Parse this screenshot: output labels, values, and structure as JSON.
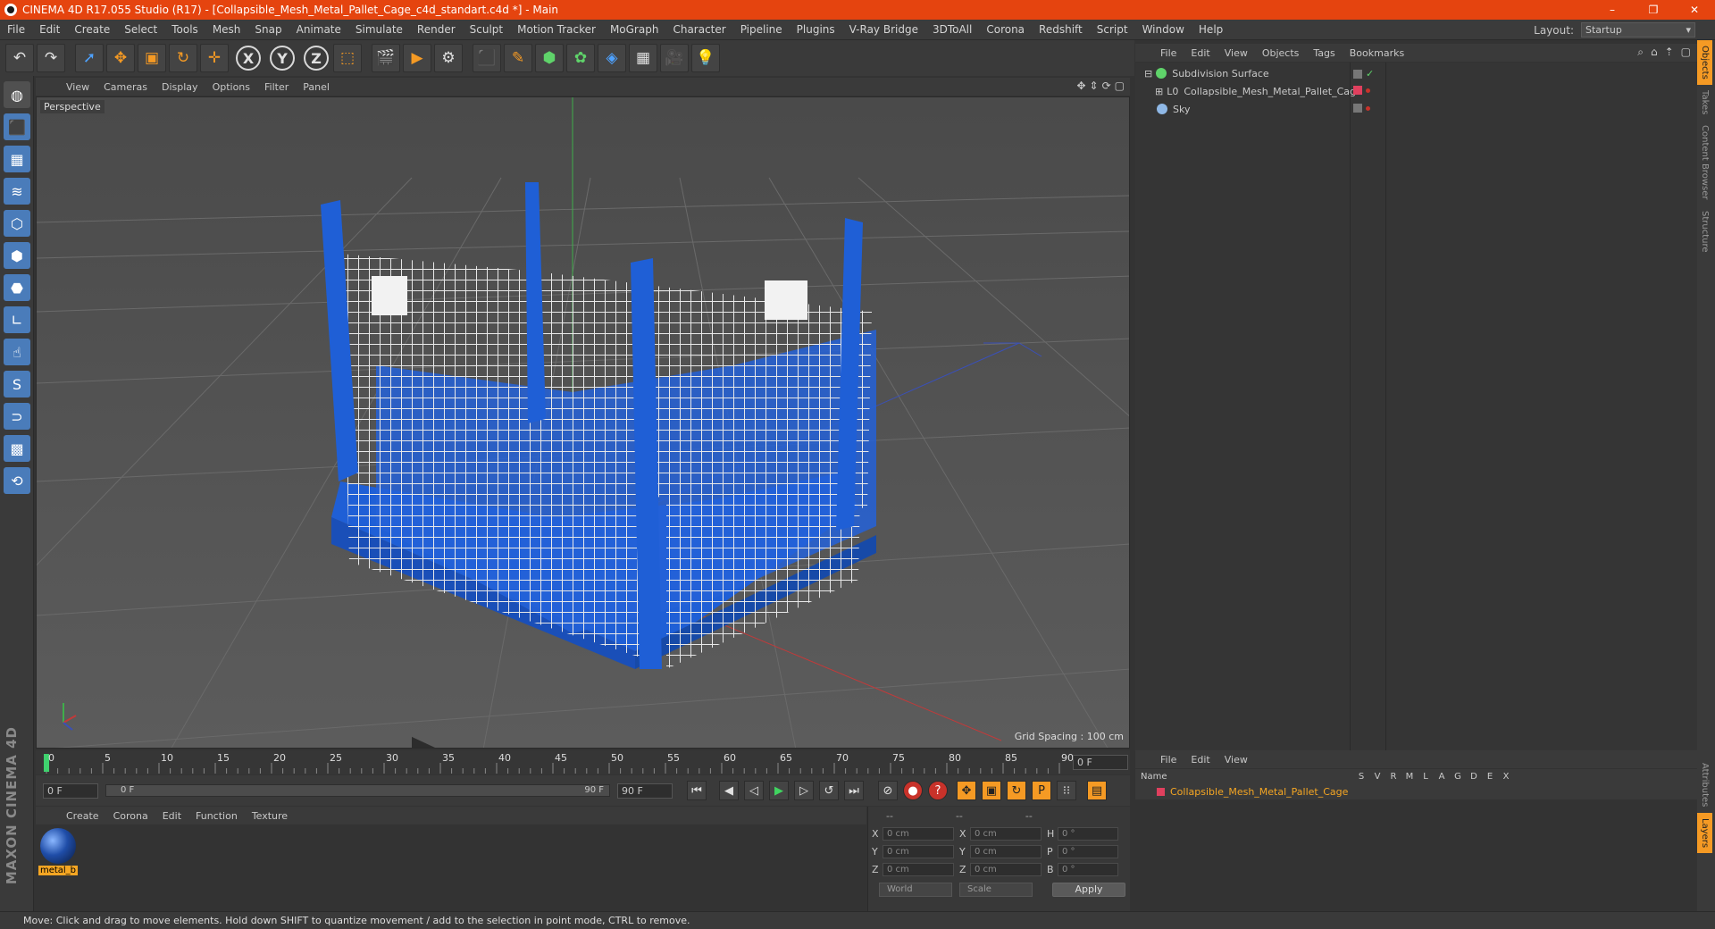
{
  "window": {
    "title": "CINEMA 4D R17.055 Studio (R17) - [Collapsible_Mesh_Metal_Pallet_Cage_c4d_standart.c4d *] - Main",
    "controls": [
      "–",
      "❐",
      "✕"
    ]
  },
  "menubar": {
    "items": [
      "File",
      "Edit",
      "Create",
      "Select",
      "Tools",
      "Mesh",
      "Snap",
      "Animate",
      "Simulate",
      "Render",
      "Sculpt",
      "Motion Tracker",
      "MoGraph",
      "Character",
      "Pipeline",
      "Plugins",
      "V-Ray Bridge",
      "3DToAll",
      "Corona",
      "Redshift",
      "Script",
      "Window",
      "Help"
    ],
    "layout_label": "Layout:",
    "layout_value": "Startup"
  },
  "toolbar": {
    "undo_icon": "↶",
    "redo_icon": "↷",
    "select_icon": "➚",
    "move_icon": "✥",
    "scale_icon": "▣",
    "rotate_icon": "↻",
    "transform_icon": "✛",
    "axis_x": "X",
    "axis_y": "Y",
    "axis_z": "Z",
    "coord_icon": "⬚",
    "render_view_icon": "🎬",
    "render_icon": "▶",
    "render_settings_icon": "⚙",
    "cube_icon": "⬛",
    "pen_icon": "✎",
    "subdiv_icon": "⬢",
    "cloner_icon": "✿",
    "deformer_icon": "◈",
    "scene_icon": "▦",
    "camera_icon": "🎥",
    "light_icon": "💡"
  },
  "left_tools": {
    "icons": [
      "◍",
      "⬛",
      "▦",
      "≋",
      "⬡",
      "⬢",
      "⬣",
      "∟",
      "☝",
      "S",
      "⊃",
      "▩",
      "⟲"
    ],
    "brand": "MAXON CINEMA 4D"
  },
  "viewport": {
    "menu": [
      "View",
      "Cameras",
      "Display",
      "Options",
      "Filter",
      "Panel"
    ],
    "nav_icons": [
      "✥",
      "⇕",
      "⟳",
      "▢"
    ],
    "camera_label": "Perspective",
    "grid_spacing": "Grid Spacing : 100 cm"
  },
  "timeline": {
    "ticks": [
      "0",
      "5",
      "10",
      "15",
      "20",
      "25",
      "30",
      "35",
      "40",
      "45",
      "50",
      "55",
      "60",
      "65",
      "70",
      "75",
      "80",
      "85",
      "90"
    ],
    "current_frame": "0 F"
  },
  "transport": {
    "start_field": "0 F",
    "slider_start": "0 F",
    "slider_end": "90 F",
    "end_field": "90 F",
    "buttons": [
      "⏮",
      "◀",
      "◁",
      "▶",
      "▷",
      "↺",
      "⏭"
    ],
    "tool_buttons": [
      "⊘",
      "●",
      "?",
      "✥",
      "▣",
      "↻",
      "P",
      "⁝⁝",
      "▤"
    ]
  },
  "material_manager": {
    "menu": [
      "Create",
      "Corona",
      "Edit",
      "Function",
      "Texture"
    ],
    "materials": [
      {
        "name": "metal_b"
      }
    ]
  },
  "coordinates": {
    "headers": [
      "--",
      "--",
      "--"
    ],
    "rows": [
      {
        "a1": "X",
        "v1": "0 cm",
        "a2": "X",
        "v2": "0 cm",
        "a3": "H",
        "v3": "0 °"
      },
      {
        "a1": "Y",
        "v1": "0 cm",
        "a2": "Y",
        "v2": "0 cm",
        "a3": "P",
        "v3": "0 °"
      },
      {
        "a1": "Z",
        "v1": "0 cm",
        "a2": "Z",
        "v2": "0 cm",
        "a3": "B",
        "v3": "0 °"
      }
    ],
    "mode_world": "World",
    "mode_scale": "Scale",
    "apply_label": "Apply"
  },
  "object_manager": {
    "menu": [
      "File",
      "Edit",
      "View",
      "Objects",
      "Tags",
      "Bookmarks"
    ],
    "objects": [
      {
        "name": "Subdivision Surface",
        "icon_color": "#5fd36a"
      },
      {
        "name": "Collapsible_Mesh_Metal_Pallet_Cage",
        "icon_color": "#cfcfcf"
      },
      {
        "name": "Sky",
        "icon_color": "#8fb8e6"
      }
    ]
  },
  "layer_manager": {
    "menu": [
      "File",
      "Edit",
      "View"
    ],
    "header_name": "Name",
    "flags": [
      "S",
      "V",
      "R",
      "M",
      "L",
      "A",
      "G",
      "D",
      "E",
      "X"
    ],
    "layers": [
      {
        "name": "Collapsible_Mesh_Metal_Pallet_Cage",
        "color": "#e0405e"
      }
    ]
  },
  "right_tabs": [
    "Objects",
    "Takes",
    "Content Browser",
    "Structure",
    "Attributes",
    "Layers"
  ],
  "status": {
    "text": "Move: Click and drag to move elements. Hold down SHIFT to quantize movement / add to the selection in point mode, CTRL to remove."
  },
  "colors": {
    "title_bar": "#e5440f",
    "accent": "#f59a24",
    "pallet_blue": "#1f5fd6",
    "mesh_white": "#e8e8e8"
  }
}
